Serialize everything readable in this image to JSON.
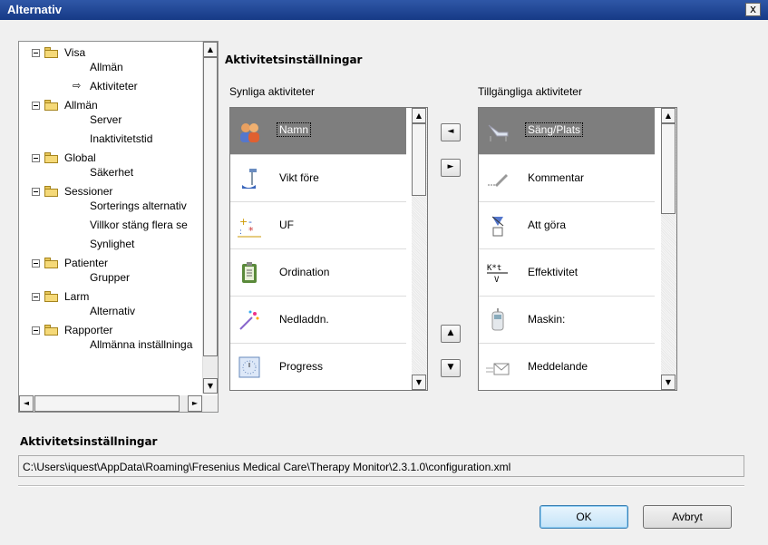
{
  "window": {
    "title": "Alternativ",
    "close_label": "x"
  },
  "tree": {
    "nodes": [
      {
        "label": "Visa",
        "level": 0
      },
      {
        "label": "Allmän",
        "level": 1
      },
      {
        "label": "Aktiviteter",
        "level": 1,
        "selected": true
      },
      {
        "label": "Allmän",
        "level": 0
      },
      {
        "label": "Server",
        "level": 1
      },
      {
        "label": "Inaktivitetstid",
        "level": 1
      },
      {
        "label": "Global",
        "level": 0
      },
      {
        "label": "Säkerhet",
        "level": 1
      },
      {
        "label": "Sessioner",
        "level": 0
      },
      {
        "label": "Sorterings alternativ",
        "level": 1
      },
      {
        "label": "Villkor stäng flera se",
        "level": 1
      },
      {
        "label": "Synlighet",
        "level": 1
      },
      {
        "label": "Patienter",
        "level": 0
      },
      {
        "label": "Grupper",
        "level": 1
      },
      {
        "label": "Larm",
        "level": 0
      },
      {
        "label": "Alternativ",
        "level": 1
      },
      {
        "label": "Rapporter",
        "level": 0
      },
      {
        "label": "Allmänna inställninga",
        "level": 1
      }
    ]
  },
  "section_title": "Aktivitetsinställningar",
  "visible_label": "Synliga aktiviteter",
  "available_label": "Tillgängliga aktiviteter",
  "visible_items": [
    {
      "label": "Namn",
      "icon": "people-icon",
      "selected": true
    },
    {
      "label": "Vikt före",
      "icon": "scale-icon"
    },
    {
      "label": "UF",
      "icon": "uf-icon"
    },
    {
      "label": "Ordination",
      "icon": "clipboard-icon"
    },
    {
      "label": "Nedladdn.",
      "icon": "wand-icon"
    },
    {
      "label": "Progress",
      "icon": "clock-icon"
    }
  ],
  "available_items": [
    {
      "label": "Säng/Plats",
      "icon": "bed-icon",
      "selected": true
    },
    {
      "label": "Kommentar",
      "icon": "pen-icon"
    },
    {
      "label": "Att göra",
      "icon": "todo-icon"
    },
    {
      "label": "Effektivitet",
      "icon": "ktv-icon",
      "icon_text": "K*t / V"
    },
    {
      "label": "Maskin:",
      "icon": "machine-icon"
    },
    {
      "label": "Meddelande",
      "icon": "envelope-icon"
    }
  ],
  "move_buttons": {
    "left": "◄",
    "right": "►",
    "up": "▲",
    "down": "▼"
  },
  "footer": {
    "title": "Aktivitetsinställningar",
    "path": "C:\\Users\\iquest\\AppData\\Roaming\\Fresenius Medical Care\\Therapy Monitor\\2.3.1.0\\configuration.xml"
  },
  "buttons": {
    "ok": "OK",
    "cancel": "Avbryt"
  }
}
